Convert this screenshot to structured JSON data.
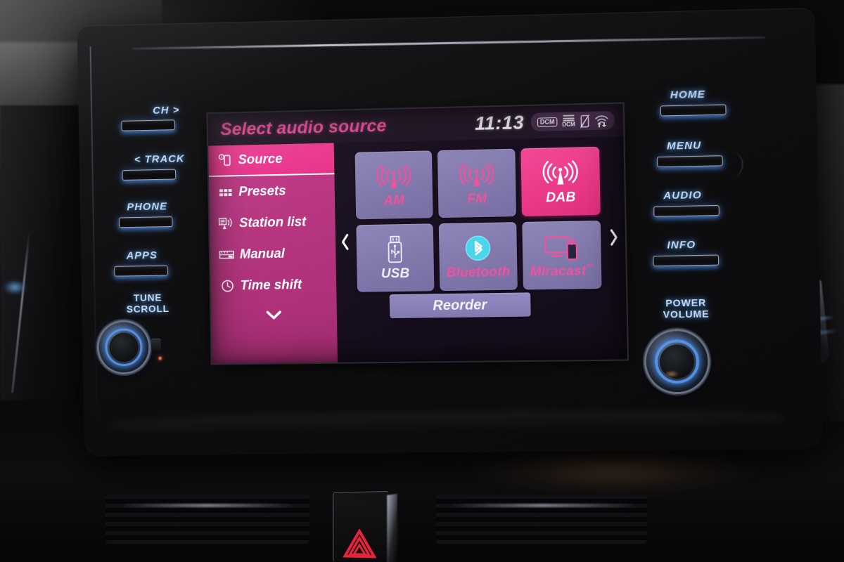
{
  "screen": {
    "status": {
      "title": "Select audio source",
      "clock": "11:13",
      "icons": [
        {
          "name": "dcm-box-icon",
          "label": "DCM"
        },
        {
          "name": "signal-bars-icon",
          "label": "DCM"
        },
        {
          "name": "phone-off-icon",
          "label": ""
        },
        {
          "name": "wifi-transfer-icon",
          "label": ""
        }
      ]
    },
    "sidebar": {
      "items": [
        {
          "label": "Source",
          "icon": "source-icon",
          "active": true
        },
        {
          "label": "Presets",
          "icon": "presets-grid-icon",
          "active": false
        },
        {
          "label": "Station list",
          "icon": "station-list-icon",
          "active": false
        },
        {
          "label": "Manual",
          "icon": "manual-tuner-icon",
          "active": false
        },
        {
          "label": "Time shift",
          "icon": "clock-icon",
          "active": false
        }
      ],
      "more_icon": "chevron-down-icon"
    },
    "nav": {
      "prev_icon": "chevron-left-icon",
      "next_icon": "chevron-right-icon"
    },
    "tiles": [
      {
        "label": "AM",
        "icon": "radio-antenna-icon",
        "active": false,
        "label_style": "pink"
      },
      {
        "label": "FM",
        "icon": "radio-antenna-icon",
        "active": false,
        "label_style": "pink"
      },
      {
        "label": "DAB",
        "icon": "radio-antenna-icon",
        "active": true,
        "label_style": "white"
      },
      {
        "label": "USB",
        "icon": "usb-stick-icon",
        "active": false,
        "label_style": "white"
      },
      {
        "label": "Bluetooth",
        "icon": "bluetooth-icon",
        "active": false,
        "label_style": "pink"
      },
      {
        "label": "Miracast",
        "label_suffix": "™",
        "icon": "miracast-cast-icon",
        "active": false,
        "label_style": "pink"
      }
    ],
    "reorder_label": "Reorder",
    "colors": {
      "accent_pink": "#e8539b",
      "tile_active": "#ea3a88",
      "tile_idle": "#8178ac",
      "sidebar": "#b3327c",
      "screen_bg": "#191020",
      "button_backlight": "#bcd8f5"
    }
  },
  "hardware": {
    "left_buttons": [
      {
        "label": "CH >",
        "name": "channel-up-button"
      },
      {
        "label": "< TRACK",
        "name": "track-prev-button"
      },
      {
        "label": "PHONE",
        "name": "phone-button"
      },
      {
        "label": "APPS",
        "name": "apps-button"
      }
    ],
    "right_buttons": [
      {
        "label": "HOME",
        "name": "home-button"
      },
      {
        "label": "MENU",
        "name": "menu-button"
      },
      {
        "label": "AUDIO",
        "name": "audio-button"
      },
      {
        "label": "INFO",
        "name": "info-button"
      }
    ],
    "left_knob": {
      "line1": "TUNE",
      "line2": "SCROLL"
    },
    "right_knob": {
      "line1": "POWER",
      "line2": "VOLUME"
    },
    "hazard": {
      "name": "hazard-warning-button"
    }
  }
}
